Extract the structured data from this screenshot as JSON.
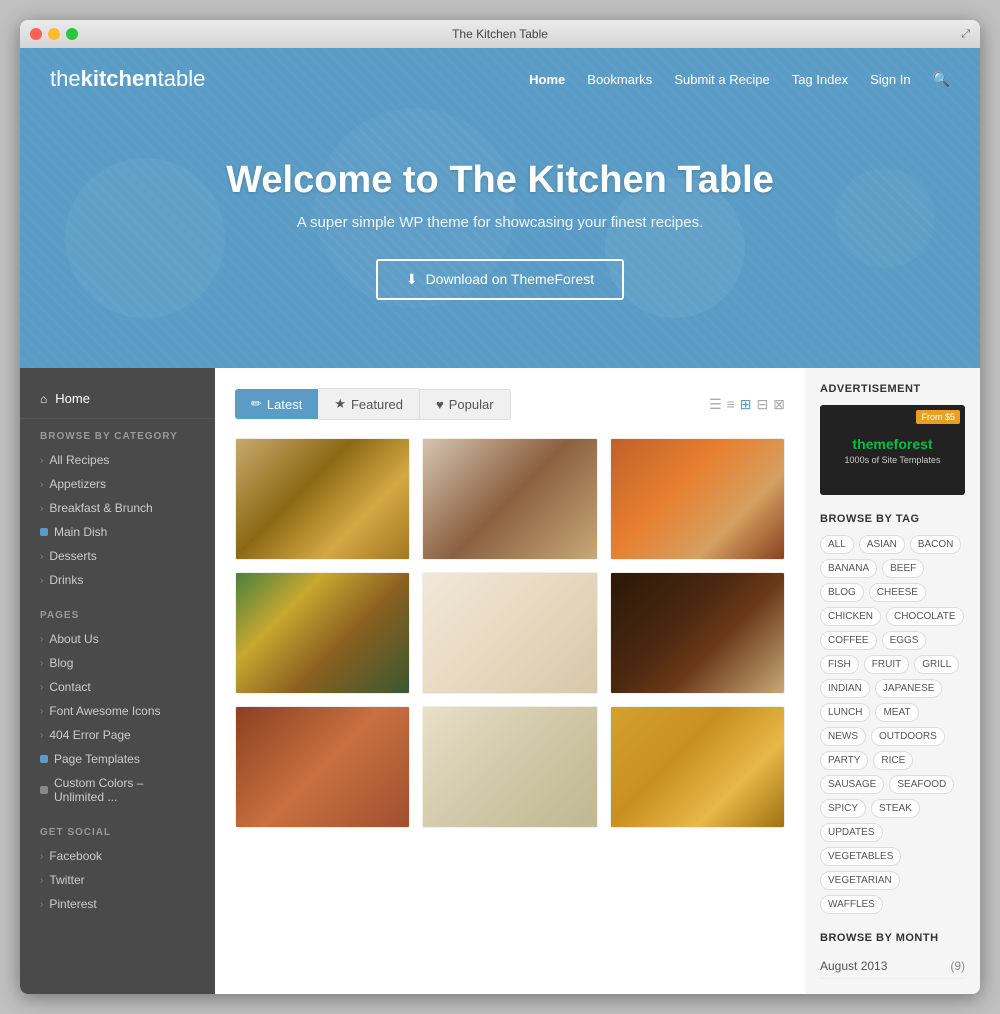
{
  "window": {
    "title": "The Kitchen Table"
  },
  "nav": {
    "logo_light": "the",
    "logo_bold": "kitchen",
    "logo_end": "table",
    "links": [
      {
        "label": "Home",
        "active": true
      },
      {
        "label": "Bookmarks",
        "active": false
      },
      {
        "label": "Submit a Recipe",
        "active": false
      },
      {
        "label": "Tag Index",
        "active": false
      },
      {
        "label": "Sign In",
        "active": false
      }
    ]
  },
  "hero": {
    "title": "Welcome to The Kitchen Table",
    "subtitle": "A super simple WP theme for showcasing your finest recipes.",
    "button_label": "Download on ThemeForest"
  },
  "sidebar": {
    "home_label": "Home",
    "browse_title": "BROWSE BY CATEGORY",
    "categories": [
      {
        "label": "All Recipes",
        "type": "arrow"
      },
      {
        "label": "Appetizers",
        "type": "arrow"
      },
      {
        "label": "Breakfast & Brunch",
        "type": "arrow"
      },
      {
        "label": "Main Dish",
        "type": "dot-blue"
      },
      {
        "label": "Desserts",
        "type": "arrow"
      },
      {
        "label": "Drinks",
        "type": "arrow"
      }
    ],
    "pages_title": "PAGES",
    "pages": [
      {
        "label": "About Us",
        "type": "arrow"
      },
      {
        "label": "Blog",
        "type": "arrow"
      },
      {
        "label": "Contact",
        "type": "arrow"
      },
      {
        "label": "Font Awesome Icons",
        "type": "arrow"
      },
      {
        "label": "404 Error Page",
        "type": "arrow"
      },
      {
        "label": "Page Templates",
        "type": "dot-blue"
      },
      {
        "label": "Custom Colors – Unlimited ...",
        "type": "dot-gray"
      }
    ],
    "social_title": "GET SOCIAL",
    "social": [
      {
        "label": "Facebook",
        "type": "arrow"
      },
      {
        "label": "Twitter",
        "type": "arrow"
      },
      {
        "label": "Pinterest",
        "type": "arrow"
      }
    ]
  },
  "tabs": [
    {
      "label": "Latest",
      "icon": "✏",
      "active": true
    },
    {
      "label": "Featured",
      "icon": "★",
      "active": false
    },
    {
      "label": "Popular",
      "icon": "♥",
      "active": false
    }
  ],
  "advertisement": {
    "title": "ADVERTISEMENT",
    "badge": "From $5",
    "logo": "themeforest",
    "tagline": "1000s of Site Templates"
  },
  "browse_by_tag": {
    "title": "BROWSE BY TAG",
    "tags": [
      "ALL",
      "ASIAN",
      "BACON",
      "BANANA",
      "BEEF",
      "BLOG",
      "CHEESE",
      "CHICKEN",
      "CHOCOLATE",
      "COFFEE",
      "EGGS",
      "FISH",
      "FRUIT",
      "GRILL",
      "INDIAN",
      "JAPANESE",
      "LUNCH",
      "MEAT",
      "NEWS",
      "OUTDOORS",
      "PARTY",
      "RICE",
      "SAUSAGE",
      "SEAFOOD",
      "SPICY",
      "STEAK",
      "UPDATES",
      "VEGETABLES",
      "VEGETARIAN",
      "WAFFLES"
    ]
  },
  "browse_by_month": {
    "title": "BROWSE BY MONTH",
    "months": [
      {
        "label": "August 2013",
        "count": "(9)"
      }
    ]
  }
}
